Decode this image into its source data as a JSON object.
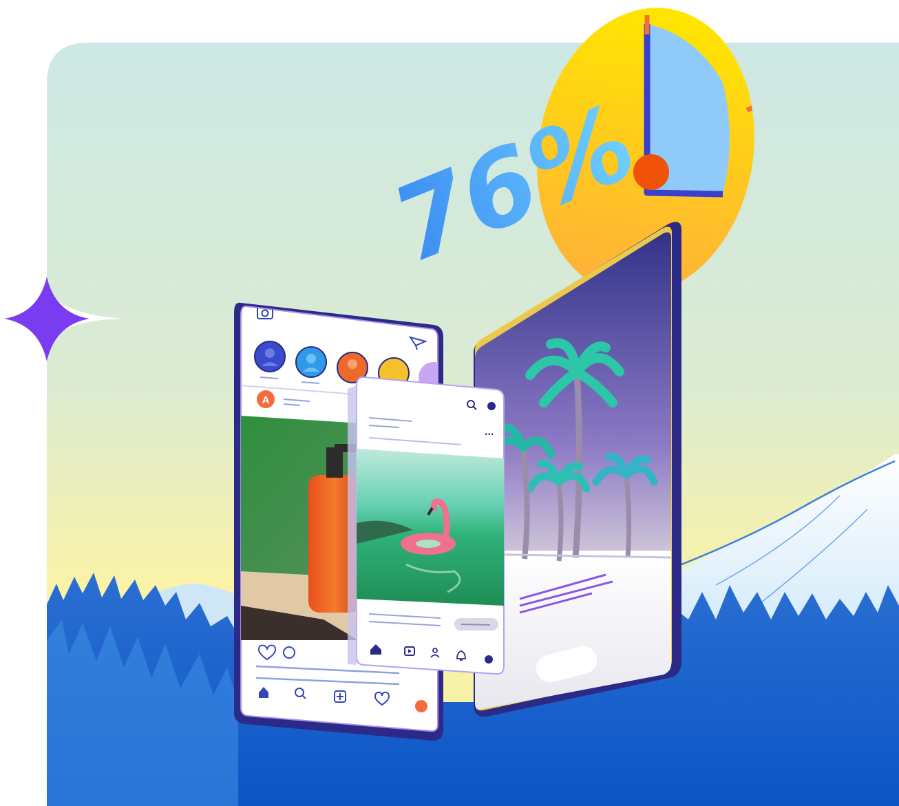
{
  "stat": {
    "value_text": "76%",
    "percent": 76
  },
  "feed_app": {
    "story_avatars": [
      "person",
      "person",
      "person",
      "person",
      "person"
    ],
    "post_author_initial": "A",
    "bottom_nav": [
      "home-icon",
      "search-icon",
      "add-post-icon",
      "heart-icon",
      "profile-dot"
    ]
  },
  "video_app": {
    "more_label": "...",
    "bottom_nav": [
      "home-icon",
      "play-icon",
      "user-icon",
      "bell-icon",
      "profile-dot"
    ]
  },
  "colors": {
    "brand_violet": "#7a3cf0",
    "stat_gradient_start": "#3b8cf2",
    "stat_gradient_end": "#5ac8ff",
    "clock_yellow": "#ffe208",
    "clock_orange": "#f0520a",
    "phone_frame": "#2b2a86",
    "forest_blue": "#1557c2"
  }
}
